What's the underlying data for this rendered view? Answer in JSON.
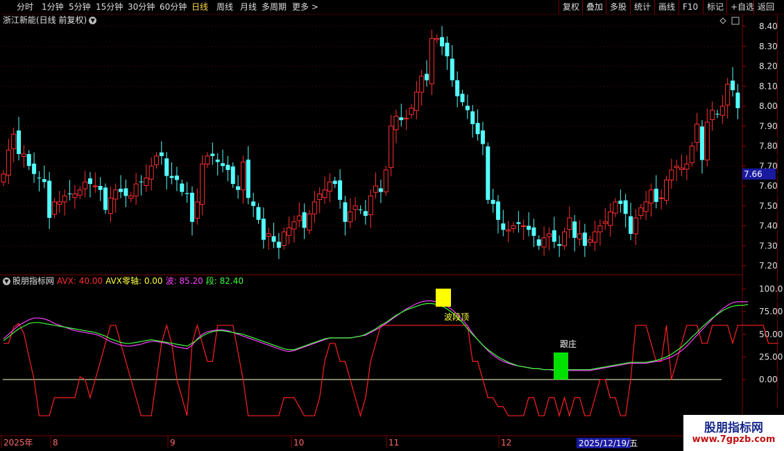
{
  "toolbar": {
    "periods": [
      {
        "label": "分时",
        "active": false
      },
      {
        "label": "1分钟",
        "active": false
      },
      {
        "label": "5分钟",
        "active": false
      },
      {
        "label": "15分钟",
        "active": false
      },
      {
        "label": "30分钟",
        "active": false
      },
      {
        "label": "60分钟",
        "active": false
      },
      {
        "label": "日线",
        "active": true
      },
      {
        "label": "周线",
        "active": false
      },
      {
        "label": "月线",
        "active": false
      },
      {
        "label": "多周期",
        "active": false
      },
      {
        "label": "更多 >",
        "active": false
      }
    ],
    "actions": [
      "复权",
      "叠加",
      "多股",
      "统计",
      "画线",
      "F10",
      "标记",
      "+自选",
      "返回"
    ]
  },
  "price_panel": {
    "title": "浙江新能(日线 前复权)",
    "current_price_tag": "7.66",
    "y_ticks": [
      "8.40",
      "8.30",
      "8.20",
      "8.10",
      "8.00",
      "7.90",
      "7.80",
      "7.70",
      "7.60",
      "7.50",
      "7.40",
      "7.30",
      "7.20"
    ]
  },
  "indicator_panel": {
    "name": "股朋指标网",
    "avx_label": "AVX: 40.00",
    "avx_zero_label": "AVX零轴: 0.00",
    "wave_label": "波: 85.20",
    "segment_label": "段: 82.40",
    "y_ticks": [
      "100.0",
      "75.00",
      "50.00",
      "25.00",
      "0.00"
    ],
    "signal_top_label": "波段顶",
    "signal_follow_label": "跟庄"
  },
  "time_axis": {
    "labels": [
      "2025年",
      "8",
      "9",
      "10",
      "11",
      "12"
    ],
    "cursor_date": "2025/12/19/五"
  },
  "watermark": {
    "title": "股朋指标网",
    "url": "www.7gpzb.com"
  },
  "colors": {
    "up": "#ff3030",
    "down": "#54ffff",
    "avx": "#ff2020",
    "wave": "#ff40ff",
    "segment": "#40ff40",
    "zero_line": "#ffffcc",
    "signal_top": "#ffff00",
    "signal_follow": "#00e000",
    "grid": "#7a0000"
  },
  "chart_data": [
    {
      "type": "candlestick",
      "title": "浙江新能(日线 前复权)",
      "ylim": [
        7.16,
        8.46
      ],
      "x_labels": [
        "2025年",
        "8",
        "9",
        "10",
        "11",
        "12"
      ],
      "closes": [
        7.66,
        7.78,
        7.86,
        7.76,
        7.76,
        7.7,
        7.66,
        7.64,
        7.62,
        7.44,
        7.52,
        7.52,
        7.55,
        7.56,
        7.56,
        7.58,
        7.62,
        7.61,
        7.6,
        7.58,
        7.48,
        7.54,
        7.58,
        7.57,
        7.55,
        7.55,
        7.61,
        7.62,
        7.64,
        7.7,
        7.75,
        7.75,
        7.65,
        7.64,
        7.63,
        7.57,
        7.56,
        7.42,
        7.52,
        7.71,
        7.75,
        7.75,
        7.72,
        7.7,
        7.68,
        7.61,
        7.58,
        7.72,
        7.54,
        7.5,
        7.43,
        7.33,
        7.36,
        7.32,
        7.29,
        7.37,
        7.39,
        7.42,
        7.45,
        7.39,
        7.46,
        7.52,
        7.56,
        7.58,
        7.62,
        7.61,
        7.53,
        7.42,
        7.47,
        7.5,
        7.48,
        7.45,
        7.55,
        7.6,
        7.57,
        7.68,
        7.9,
        7.95,
        7.93,
        7.94,
        7.99,
        8.07,
        8.15,
        8.13,
        8.34,
        8.34,
        8.3,
        8.25,
        8.13,
        8.05,
        8.02,
        7.98,
        7.91,
        7.86,
        7.81,
        7.53,
        7.51,
        7.43,
        7.38,
        7.38,
        7.4,
        7.41,
        7.4,
        7.38,
        7.35,
        7.3,
        7.34,
        7.36,
        7.32,
        7.3,
        7.37,
        7.44,
        7.34,
        7.36,
        7.3,
        7.33,
        7.37,
        7.4,
        7.42,
        7.47,
        7.52,
        7.51,
        7.46,
        7.36,
        7.44,
        7.49,
        7.52,
        7.58,
        7.52,
        7.54,
        7.63,
        7.68,
        7.7,
        7.69,
        7.71,
        7.8,
        7.91,
        7.73,
        7.92,
        7.98,
        7.96,
        8.0,
        8.11,
        8.08,
        7.99
      ]
    },
    {
      "type": "line",
      "title": "股朋指标网",
      "ylim": [
        -25,
        112
      ],
      "series": [
        {
          "name": "AVX",
          "values": [
            40,
            40,
            58,
            62,
            51,
            25,
            0,
            -40,
            -40,
            -40,
            -20,
            -20,
            -20,
            -20,
            -20,
            3,
            0,
            -20,
            0,
            20,
            40,
            60,
            60,
            40,
            20,
            0,
            -20,
            -40,
            -40,
            -40,
            0,
            40,
            60,
            40,
            0,
            -20,
            -40,
            40,
            60,
            40,
            20,
            20,
            60,
            60,
            60,
            60,
            30,
            0,
            -40,
            -40,
            -40,
            -40,
            -40,
            -40,
            -40,
            -20,
            -20,
            -20,
            -30,
            -40,
            -40,
            -40,
            -20,
            20,
            40,
            40,
            20,
            20,
            0,
            -20,
            -40,
            -20,
            20,
            40,
            60,
            60,
            60,
            60,
            60,
            60,
            60,
            60,
            60,
            60,
            60,
            60,
            60,
            60,
            60,
            60,
            60,
            60,
            20,
            20,
            0,
            -20,
            -20,
            -30,
            -30,
            -40,
            -40,
            -40,
            -40,
            -20,
            -20,
            -40,
            -40,
            -20,
            -20,
            -40,
            -20,
            -40,
            -20,
            -20,
            -40,
            -40,
            -20,
            0,
            0,
            -20,
            -20,
            -40,
            -40,
            0,
            60,
            60,
            60,
            40,
            20,
            20,
            60,
            0,
            20,
            40,
            60,
            60,
            60,
            40,
            40,
            60,
            60,
            60,
            60,
            40,
            60,
            60,
            60,
            60,
            60,
            60,
            40,
            40,
            40
          ]
        },
        {
          "name": "波",
          "values": [
            45,
            50,
            55,
            60,
            63,
            66,
            68,
            68,
            67,
            65,
            62,
            60,
            58,
            56,
            54,
            53,
            52,
            51,
            50,
            48,
            45,
            42,
            40,
            38,
            37,
            37,
            38,
            39,
            41,
            42,
            42,
            41,
            40,
            38,
            36,
            35,
            34,
            38,
            45,
            50,
            53,
            54,
            55,
            55,
            54,
            52,
            50,
            48,
            46,
            44,
            42,
            40,
            38,
            36,
            34,
            32,
            31,
            32,
            34,
            36,
            38,
            40,
            42,
            44,
            46,
            46,
            46,
            46,
            46,
            47,
            48,
            49,
            52,
            55,
            58,
            62,
            66,
            70,
            74,
            78,
            81,
            84,
            86,
            87,
            87,
            86,
            84,
            81,
            77,
            72,
            66,
            59,
            51,
            44,
            38,
            32,
            27,
            23,
            20,
            18,
            16,
            15,
            14,
            13,
            12,
            12,
            11,
            11,
            10,
            10,
            10,
            10,
            10,
            10,
            10,
            10,
            11,
            12,
            13,
            14,
            15,
            16,
            17,
            18,
            18,
            18,
            18,
            19,
            20,
            21,
            23,
            25,
            28,
            32,
            37,
            43,
            49,
            55,
            61,
            67,
            73,
            78,
            82,
            85,
            86,
            86,
            86
          ]
        },
        {
          "name": "段",
          "values": [
            43,
            47,
            52,
            56,
            59,
            62,
            63,
            63,
            62,
            61,
            60,
            59,
            58,
            57,
            56,
            55,
            54,
            53,
            52,
            50,
            48,
            45,
            43,
            41,
            40,
            40,
            41,
            42,
            43,
            44,
            43,
            42,
            41,
            40,
            39,
            38,
            37,
            40,
            44,
            48,
            51,
            53,
            54,
            54,
            53,
            52,
            51,
            50,
            48,
            46,
            44,
            42,
            40,
            38,
            36,
            34,
            33,
            33,
            35,
            37,
            39,
            41,
            43,
            45,
            46,
            46,
            46,
            46,
            46,
            47,
            48,
            50,
            53,
            56,
            60,
            63,
            67,
            71,
            74,
            77,
            79,
            81,
            83,
            84,
            84,
            83,
            81,
            78,
            74,
            69,
            63,
            56,
            50,
            44,
            38,
            33,
            29,
            25,
            22,
            19,
            17,
            15,
            14,
            13,
            12,
            12,
            11,
            11,
            11,
            11,
            11,
            11,
            11,
            11,
            11,
            11,
            12,
            13,
            14,
            15,
            16,
            17,
            18,
            19,
            19,
            19,
            19,
            20,
            21,
            23,
            25,
            28,
            32,
            36,
            41,
            47,
            52,
            58,
            63,
            68,
            72,
            76,
            79,
            81,
            82,
            82,
            83
          ]
        }
      ],
      "zero_line": 0
    }
  ]
}
